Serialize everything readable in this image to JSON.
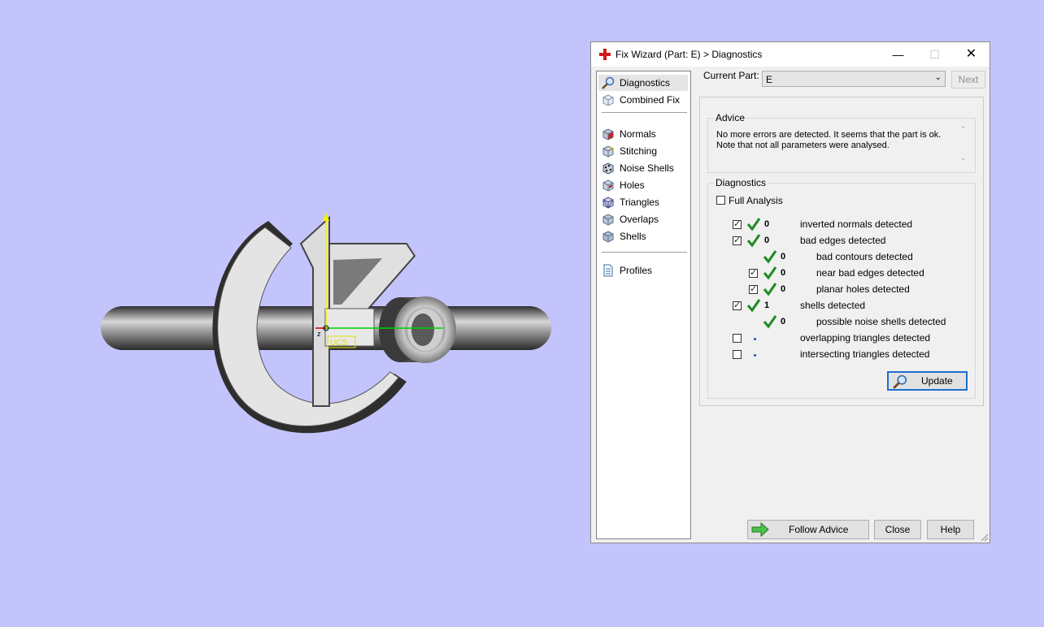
{
  "viewport": {
    "axis_z_label": "z",
    "ucs_label": "UCS"
  },
  "dialog": {
    "title": "Fix Wizard (Part: E) > Diagnostics",
    "minimize": "—",
    "maximize": "☐",
    "close": "✕"
  },
  "nav": {
    "items": [
      {
        "label": "Diagnostics",
        "icon": "magnifier-icon"
      },
      {
        "label": "Combined Fix",
        "icon": "cube-icon"
      },
      {
        "label": "Normals",
        "icon": "normals-cube-icon"
      },
      {
        "label": "Stitching",
        "icon": "stitching-cube-icon"
      },
      {
        "label": "Noise Shells",
        "icon": "noise-shells-icon"
      },
      {
        "label": "Holes",
        "icon": "holes-cube-icon"
      },
      {
        "label": "Triangles",
        "icon": "triangles-cube-icon"
      },
      {
        "label": "Overlaps",
        "icon": "overlaps-cube-icon"
      },
      {
        "label": "Shells",
        "icon": "shells-cube-icon"
      },
      {
        "label": "Profiles",
        "icon": "document-icon"
      }
    ]
  },
  "current_part": {
    "label": "Current Part:",
    "value": "E",
    "next": "Next"
  },
  "advice": {
    "title": "Advice",
    "line1": "No more errors are detected. It seems that the part is ok.",
    "line2": "Note that not all parameters were analysed."
  },
  "diagnostics": {
    "title": "Diagnostics",
    "full_analysis": "Full Analysis",
    "rows": [
      {
        "count": "0",
        "label": "inverted normals detected"
      },
      {
        "count": "0",
        "label": "bad edges detected"
      },
      {
        "count": "0",
        "label": "bad contours detected"
      },
      {
        "count": "0",
        "label": "near bad edges detected"
      },
      {
        "count": "0",
        "label": "planar holes detected"
      },
      {
        "count": "1",
        "label": "shells detected"
      },
      {
        "count": "0",
        "label": "possible noise shells detected"
      },
      {
        "count": "",
        "label": "overlapping triangles detected"
      },
      {
        "count": "",
        "label": "intersecting triangles detected"
      }
    ],
    "update": "Update"
  },
  "footer": {
    "follow_advice": "Follow Advice",
    "close": "Close",
    "help": "Help"
  },
  "colors": {
    "background": "#c4c4fc",
    "check_green": "#1f8a1f",
    "accent_blue": "#1e6fd0"
  }
}
